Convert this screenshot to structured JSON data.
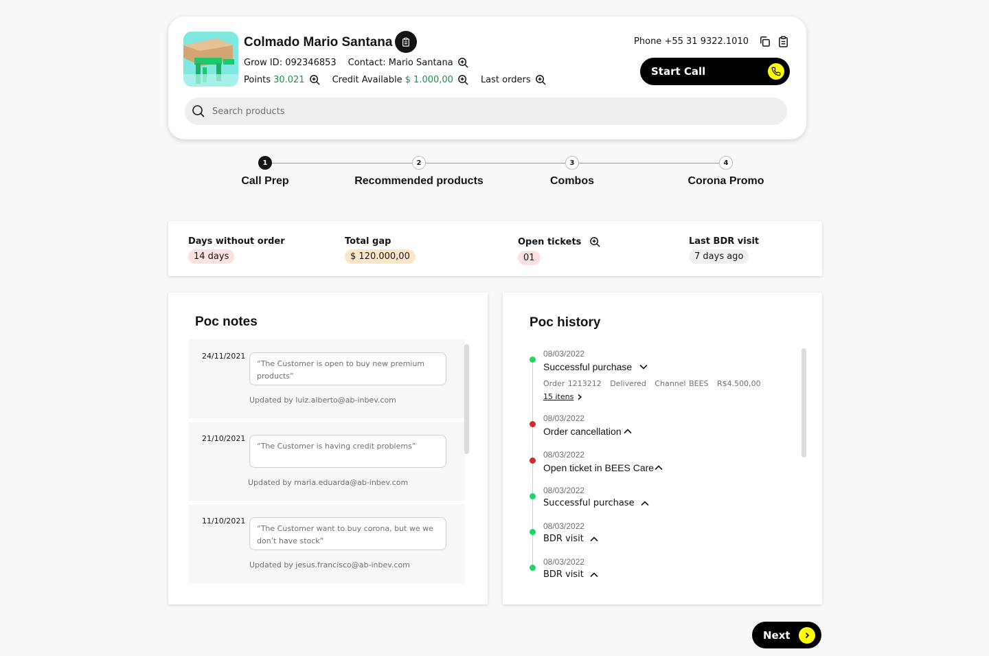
{
  "colors": {
    "accent_yellow": "#ffff00",
    "primary_black": "#000000",
    "money_green": "#1f8e4a",
    "success_dot": "#1ed760",
    "cancel_dot": "#d12a2a",
    "badge_red": "#fde0e0",
    "badge_orange": "#fde6c8",
    "badge_gray": "#f0f0f0"
  },
  "header": {
    "poc_name": "Colmado Mario Santana",
    "grow_id_label": "Grow ID:",
    "grow_id_value": "092346853",
    "contact_label": "Contact:",
    "contact_value": "Mario Santana",
    "points_label": "Points",
    "points_value": "30.021",
    "credit_label": "Credit Available",
    "credit_value": "$ 1.000,00",
    "last_orders_label": "Last orders",
    "phone_label": "Phone",
    "phone_value": "+55 31 9322.1010",
    "start_call_label": "Start Call",
    "search_placeholder": "Search products"
  },
  "stepper": {
    "steps": [
      {
        "number": "1",
        "label": "Call Prep",
        "active": true
      },
      {
        "number": "2",
        "label": "Recommended products",
        "active": false
      },
      {
        "number": "3",
        "label": "Combos",
        "active": false
      },
      {
        "number": "4",
        "label": "Corona Promo",
        "active": false
      }
    ]
  },
  "kpis": [
    {
      "title": "Days without order",
      "value": "14 days",
      "badge_color": "badge_red"
    },
    {
      "title": "Total gap",
      "value": "$ 120.000,00",
      "badge_color": "badge_orange"
    },
    {
      "title": "Open tickets",
      "value": "01",
      "badge_color": "badge_red"
    },
    {
      "title": "Last BDR visit",
      "value": "7 days ago",
      "badge_color": "badge_gray"
    }
  ],
  "poc_notes": {
    "title": "Poc notes",
    "notes": [
      {
        "date": "24/11/2021",
        "text": "“The Customer is open to buy new premium products”",
        "updated": "Updated by luiz.alberto@ab-inbev.com"
      },
      {
        "date": "21/10/2021",
        "text": "“The Customer is having credit problems”",
        "updated": "Updated by maria.eduarda@ab-inbev.com"
      },
      {
        "date": "11/10/2021",
        "text": "“The Customer want to buy corona, but we we don’t have stock”",
        "updated": "Updated by jesus.francisco@ab-inbev.com"
      }
    ]
  },
  "poc_history": {
    "title": "Poc history",
    "items": [
      {
        "date": "08/03/2022",
        "title": "Successful purchase",
        "status": "success",
        "chevron": "chevron-down-icon",
        "details": {
          "order": "Order 1213212",
          "status": "Delivered",
          "channel": "Channel BEES",
          "amount": "R$4.500,00"
        },
        "link": "15 itens"
      },
      {
        "date": "08/03/2022",
        "title": "Order cancellation",
        "status": "cancel",
        "chevron": "chevron-up-icon"
      },
      {
        "date": "08/03/2022",
        "title": "Open ticket in BEES Care",
        "status": "cancel",
        "chevron": "chevron-up-icon"
      },
      {
        "date": "08/03/2022",
        "title": "Successful purchase",
        "status": "success",
        "chevron": "chevron-up-icon"
      },
      {
        "date": "08/03/2022",
        "title": "BDR visit",
        "status": "success",
        "chevron": "chevron-up-icon"
      },
      {
        "date": "08/03/2022",
        "title": "BDR visit",
        "status": "success",
        "chevron": "chevron-up-icon"
      }
    ]
  },
  "footer": {
    "next_label": "Next"
  }
}
